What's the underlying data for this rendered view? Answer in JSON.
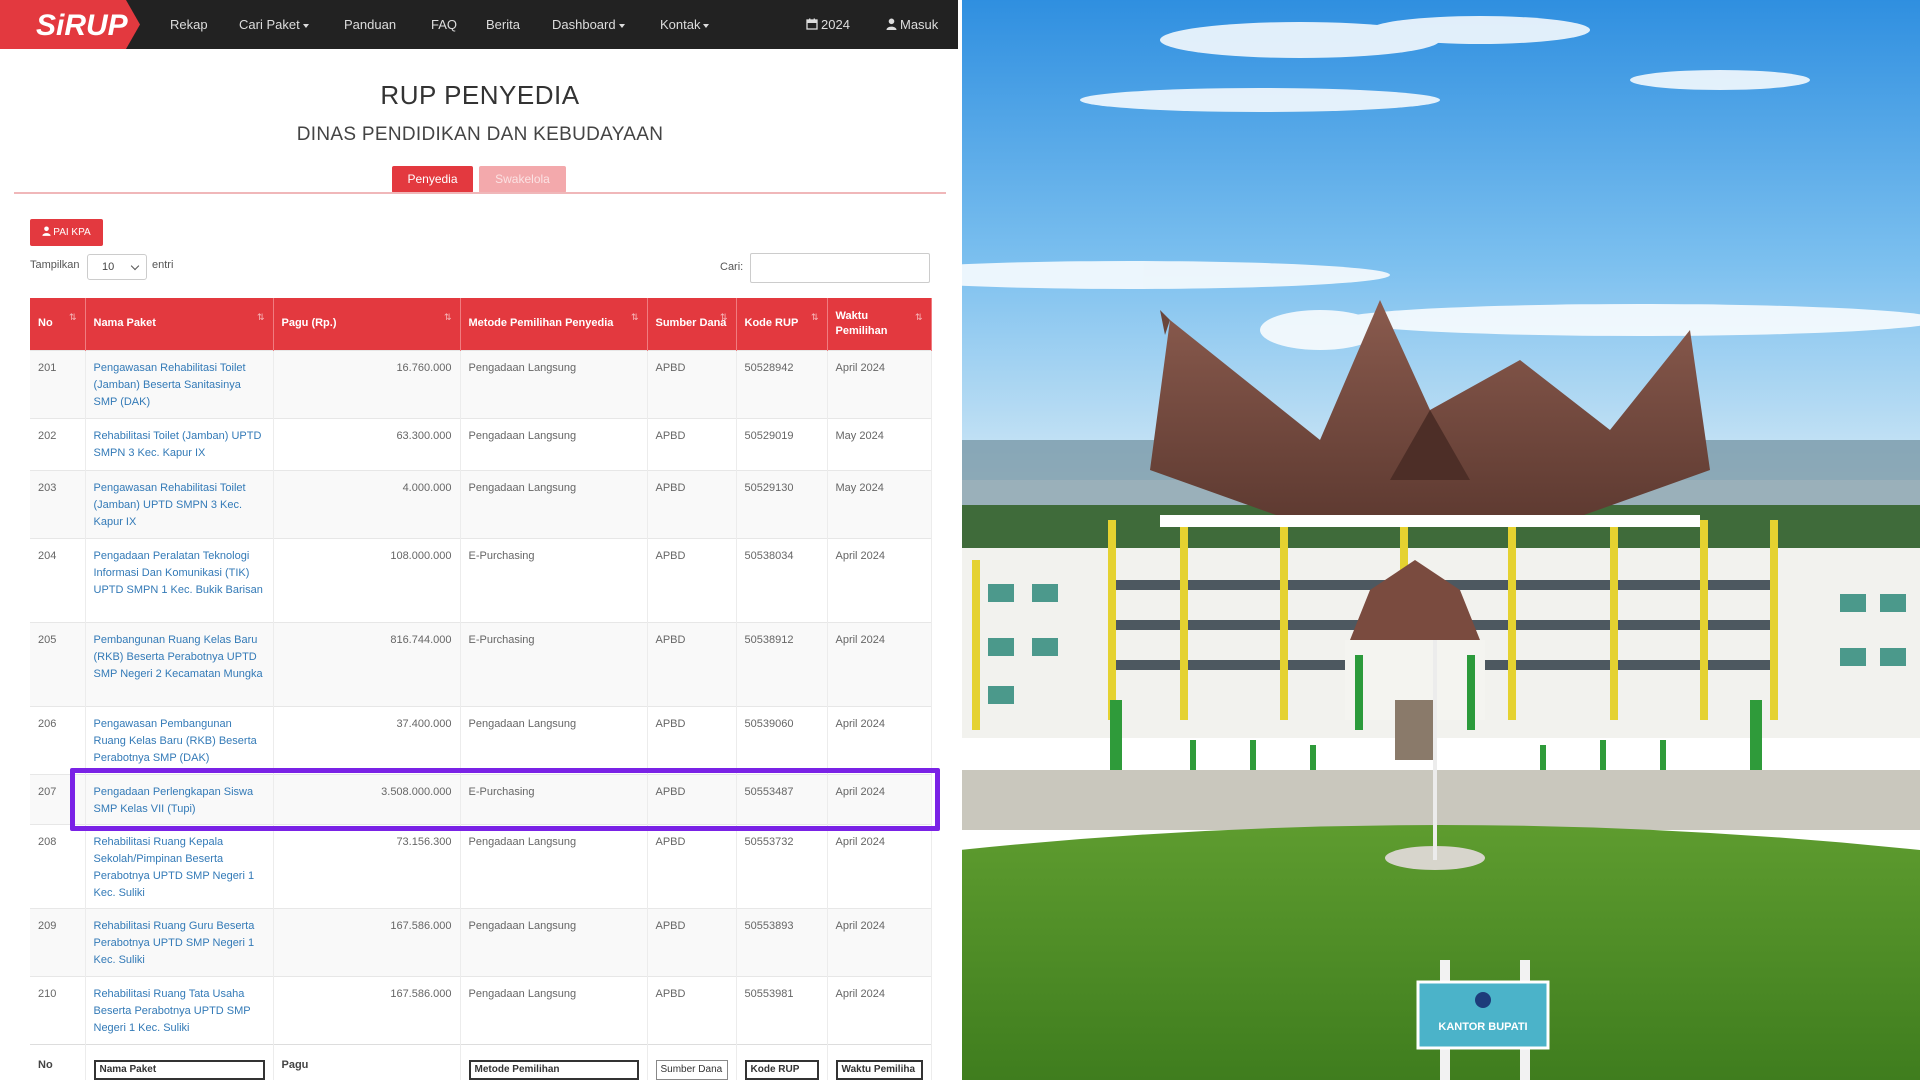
{
  "navbar": {
    "logo_text": "SiRUP",
    "items": [
      {
        "label": "Rekap",
        "active": true,
        "dropdown": false
      },
      {
        "label": "Cari Paket",
        "active": false,
        "dropdown": true
      },
      {
        "label": "Panduan",
        "active": false,
        "dropdown": false
      },
      {
        "label": "FAQ",
        "active": false,
        "dropdown": false
      },
      {
        "label": "Berita",
        "active": false,
        "dropdown": false
      },
      {
        "label": "Dashboard",
        "active": false,
        "dropdown": true
      },
      {
        "label": "Kontak",
        "active": false,
        "dropdown": true
      }
    ],
    "year": "2024",
    "year_icon": "calendar-icon",
    "login_label": "Masuk",
    "login_icon": "user-icon"
  },
  "page": {
    "title": "RUP PENYEDIA",
    "subtitle": "DINAS PENDIDIKAN DAN KEBUDAYAAN"
  },
  "tabs": [
    {
      "label": "Penyedia",
      "active": true
    },
    {
      "label": "Swakelola",
      "active": false
    }
  ],
  "rup_button": {
    "label": "PAI KPA",
    "icon": "user-icon"
  },
  "table_controls": {
    "show_label": "Tampilkan",
    "show_value": "10",
    "entries_label": "entri",
    "search_label": "Cari:",
    "search_value": ""
  },
  "table": {
    "columns": [
      "No",
      "Nama Paket",
      "Pagu (Rp.)",
      "Metode Pemilihan Penyedia",
      "Sumber Dana",
      "Kode RUP",
      "Waktu Pemilihan"
    ],
    "rows": [
      [
        "201",
        "Pengawasan Rehabilitasi Toilet (Jamban) Beserta Sanitasinya SMP (DAK)",
        "16.760.000",
        "Pengadaan Langsung",
        "APBD",
        "50528942",
        "April 2024"
      ],
      [
        "202",
        "Rehabilitasi Toilet (Jamban) UPTD SMPN 3 Kec. Kapur IX",
        "63.300.000",
        "Pengadaan Langsung",
        "APBD",
        "50529019",
        "May 2024"
      ],
      [
        "203",
        "Pengawasan Rehabilitasi Toilet (Jamban) UPTD SMPN 3 Kec. Kapur IX",
        "4.000.000",
        "Pengadaan Langsung",
        "APBD",
        "50529130",
        "May 2024"
      ],
      [
        "204",
        "Pengadaan Peralatan Teknologi Informasi Dan Komunikasi (TIK) UPTD SMPN 1 Kec. Bukik Barisan",
        "108.000.000",
        "E-Purchasing",
        "APBD",
        "50538034",
        "April 2024"
      ],
      [
        "205",
        "Pembangunan Ruang Kelas Baru (RKB) Beserta Perabotnya UPTD SMP Negeri 2 Kecamatan Mungka",
        "816.744.000",
        "E-Purchasing",
        "APBD",
        "50538912",
        "April 2024"
      ],
      [
        "206",
        "Pengawasan Pembangunan Ruang Kelas Baru (RKB) Beserta Perabotnya SMP (DAK)",
        "37.400.000",
        "Pengadaan Langsung",
        "APBD",
        "50539060",
        "April 2024"
      ],
      [
        "207",
        "Pengadaan Perlengkapan Siswa SMP Kelas VII (Tupi)",
        "3.508.000.000",
        "E-Purchasing",
        "APBD",
        "50553487",
        "April 2024"
      ],
      [
        "208",
        "Rehabilitasi Ruang Kepala Sekolah/Pimpinan Beserta Perabotnya UPTD SMP Negeri 1 Kec. Suliki",
        "73.156.300",
        "Pengadaan Langsung",
        "APBD",
        "50553732",
        "April 2024"
      ],
      [
        "209",
        "Rehabilitasi Ruang Guru Beserta Perabotnya UPTD SMP Negeri 1 Kec. Suliki",
        "167.586.000",
        "Pengadaan Langsung",
        "APBD",
        "50553893",
        "April 2024"
      ],
      [
        "210",
        "Rehabilitasi Ruang Tata Usaha Beserta Perabotnya UPTD SMP Negeri 1 Kec. Suliki",
        "167.586.000",
        "Pengadaan Langsung",
        "APBD",
        "50553981",
        "April 2024"
      ]
    ],
    "highlighted_row": "207",
    "footer": {
      "no": "No",
      "nama_placeholder": "Nama Paket",
      "pagu": "Pagu",
      "metode_placeholder": "Metode Pemilihan",
      "sumber_placeholder": "Sumber Dana",
      "kode_placeholder": "Kode RUP",
      "waktu_placeholder": "Waktu Pemiliha"
    }
  },
  "colors": {
    "brand_red": "#e3393f",
    "navbar_bg": "#222222",
    "highlight": "#7a22e6",
    "link": "#337ab7"
  },
  "photo": {
    "signboard_text": "KANTOR BUPATI"
  }
}
